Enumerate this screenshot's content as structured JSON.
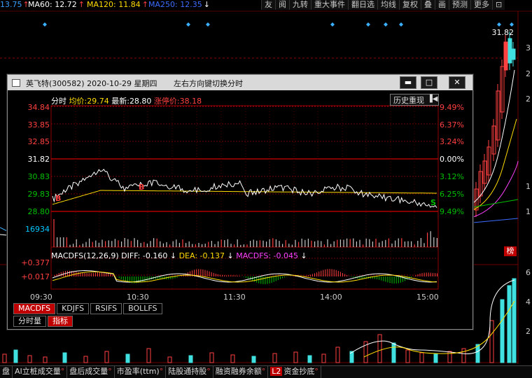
{
  "ma_bar": {
    "ma_partial": "13.75",
    "ma60_label": "MA60: 12.72",
    "ma120_label": "MA120: 11.84",
    "ma250_label": "MA250: 12.35",
    "up_arrow": "↑",
    "down_arrow": "↓",
    "colors": {
      "ma_partial": "#3aa0ff",
      "ma60": "#ffffff",
      "ma120": "#ffdc00",
      "ma250": "#3c6cff",
      "up": "#ff4040",
      "down": "#ffffff"
    }
  },
  "toolbar": [
    "友",
    "阅",
    "九转",
    "重大事件",
    "翻日选",
    "均线",
    "复权",
    "叠",
    "画",
    "预测",
    "更多"
  ],
  "main_chart": {
    "peak_label": "31.82",
    "right_labels": [
      "3",
      "2",
      "2",
      "1",
      "1"
    ],
    "mark_right": "榜",
    "vol_labels": [
      "6",
      "4",
      "2"
    ]
  },
  "popup": {
    "title": "英飞特(300582) 2020-10-29 星期四",
    "hint": "左右方向键切换分时",
    "btn_min": "▬",
    "btn_max": "□",
    "btn_close": "✕",
    "info": {
      "label": "分时",
      "avg_label": "均价:",
      "avg": "29.74",
      "last_label": "最新:",
      "last": "28.80",
      "limit_label": "涨停价:",
      "limit": "38.18"
    },
    "history_btn": "历史重现",
    "price_axis": [
      {
        "v": "34.84",
        "c": "#ff4040"
      },
      {
        "v": "33.85",
        "c": "#ff4040"
      },
      {
        "v": "32.85",
        "c": "#ff4040"
      },
      {
        "v": "31.82",
        "c": "#ffffff"
      },
      {
        "v": "30.83",
        "c": "#00c000"
      },
      {
        "v": "29.83",
        "c": "#00c000"
      },
      {
        "v": "28.80",
        "c": "#00c000"
      }
    ],
    "pct_axis": [
      {
        "v": "9.49%",
        "c": "#ff4040"
      },
      {
        "v": "6.37%",
        "c": "#ff4040"
      },
      {
        "v": "3.24%",
        "c": "#ff4040"
      },
      {
        "v": "0.00%",
        "c": "#ffffff"
      },
      {
        "v": "3.12%",
        "c": "#00c000"
      },
      {
        "v": "6.25%",
        "c": "#00c000"
      },
      {
        "v": "9.49%",
        "c": "#00c000"
      }
    ],
    "volume_label": "16934",
    "macd_axis": [
      "+0.377",
      "+0.017"
    ],
    "macd": {
      "title": "MACDFS(12,26,9)",
      "diff": "DIFF: -0.160",
      "dea": "DEA: -0.137",
      "macdfs": "MACDFS: -0.045"
    },
    "times": [
      "09:30",
      "10:30",
      "11:30",
      "14:00",
      "15:00"
    ],
    "tabs": [
      "MACDFS",
      "KDJFS",
      "RSIFS",
      "BOLLFS"
    ],
    "tabs2": [
      "分时量",
      "指标"
    ],
    "signals": [
      "B",
      "B",
      "S"
    ]
  },
  "bottom_tabs": [
    "盘",
    "AI立桩成交量",
    "盘后成交量",
    "市盈率(ttm)",
    "陆股通持股",
    "融资融券余额",
    "资金抄底"
  ],
  "bottom_l2": "L2"
}
